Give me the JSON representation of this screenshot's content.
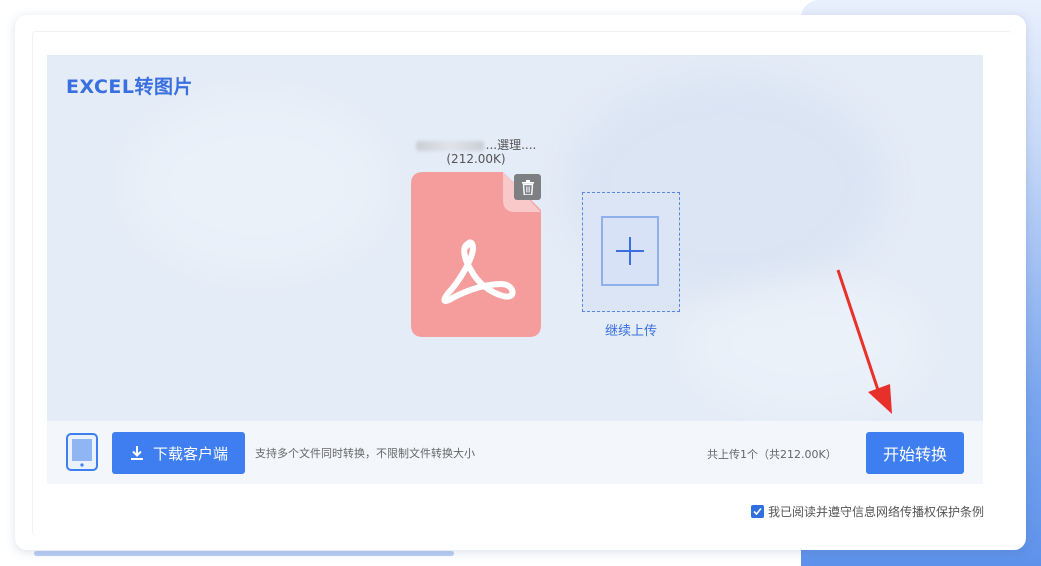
{
  "page": {
    "title": "EXCEL转图片"
  },
  "file": {
    "name_suffix": "…泳人…表...",
    "name_visible": "...選理....",
    "size": "(212.00K)",
    "icon": "pdf-file-icon",
    "delete_icon": "trash-icon"
  },
  "upload_more": {
    "label": "继续上传",
    "icon": "plus-icon"
  },
  "toolbar": {
    "device_icon": "tablet-icon",
    "download_label": "下载客户端",
    "download_icon": "download-icon",
    "support_text": "支持多个文件同时转换，不限制文件转换大小",
    "upload_count": "共上传1个（共212.00K）",
    "start_label": "开始转换"
  },
  "agreement": {
    "checked": true,
    "text": "我已阅读并遵守信息网络传播权保护条例"
  },
  "colors": {
    "accent": "#3e7ef0",
    "title": "#3a6fe0",
    "file_icon": "#f59d9d",
    "arrow": "#e8302a"
  }
}
